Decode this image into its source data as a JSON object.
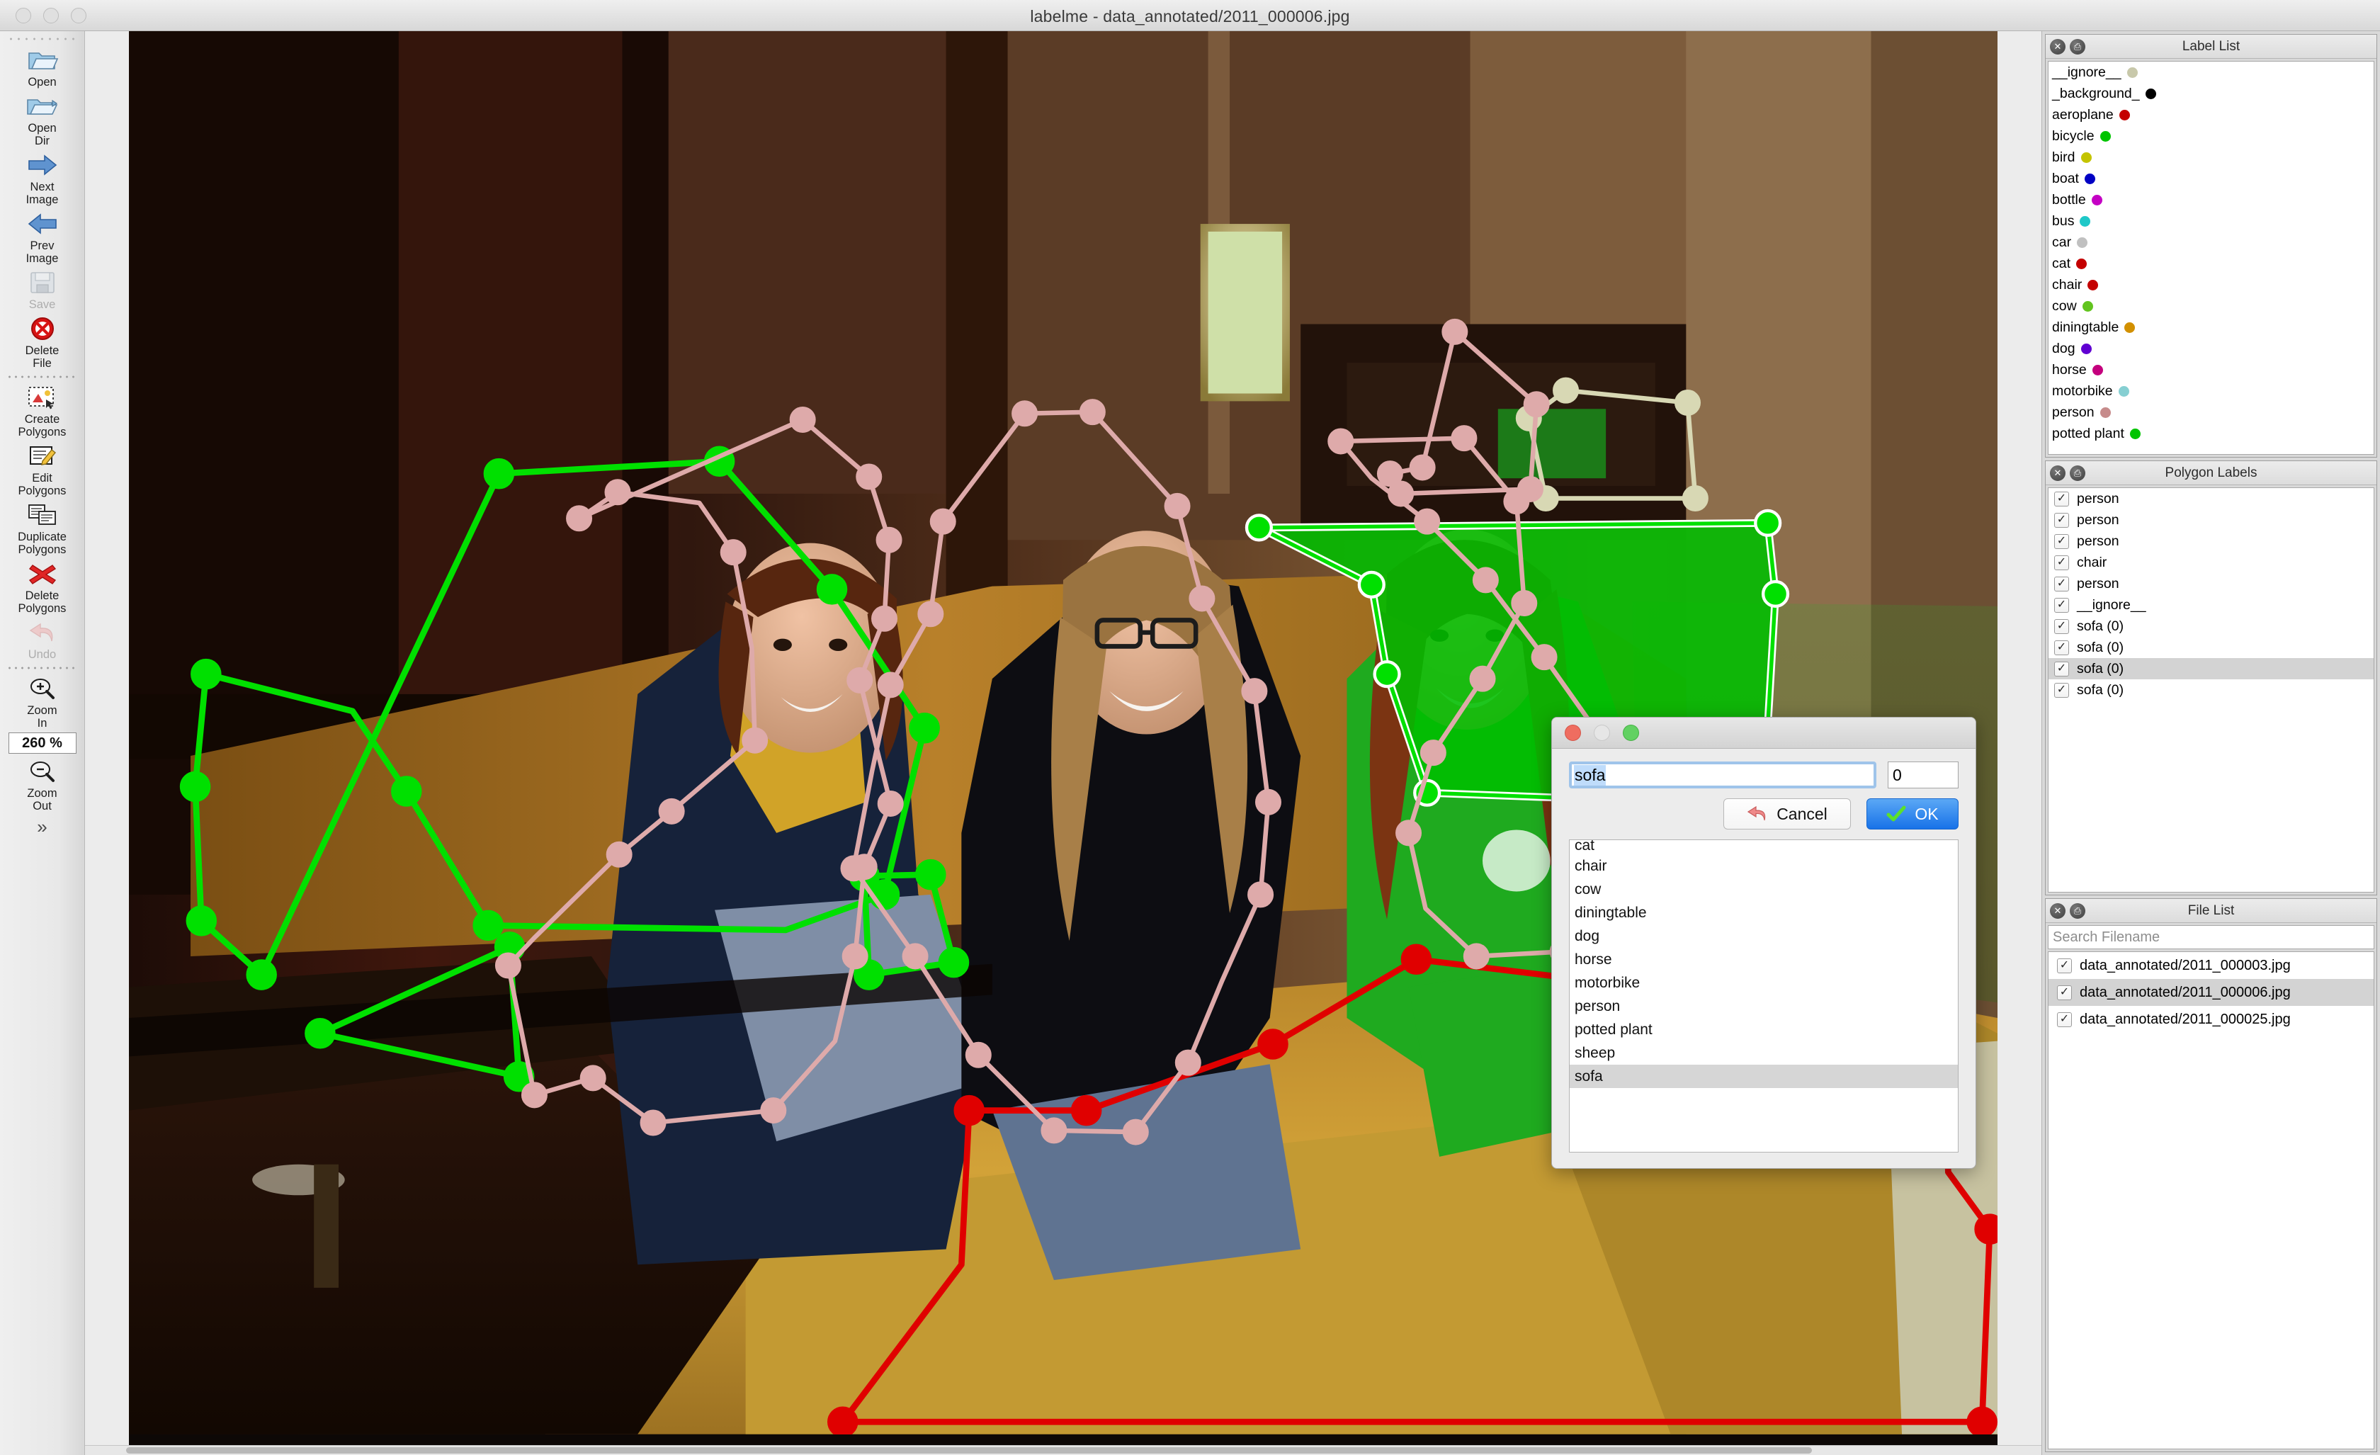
{
  "window": {
    "title": "labelme - data_annotated/2011_000006.jpg",
    "traffic": [
      "close",
      "minimize",
      "zoom"
    ]
  },
  "toolbar": {
    "items": [
      {
        "name": "open",
        "label": "Open",
        "icon": "open-folder-icon",
        "disabled": false
      },
      {
        "name": "open-dir",
        "label": "Open\nDir",
        "icon": "open-dir-icon",
        "disabled": false
      },
      {
        "name": "next-image",
        "label": "Next\nImage",
        "icon": "arrow-right-icon",
        "disabled": false
      },
      {
        "name": "prev-image",
        "label": "Prev\nImage",
        "icon": "arrow-left-icon",
        "disabled": false
      },
      {
        "name": "save",
        "label": "Save",
        "icon": "floppy-disk-icon",
        "disabled": true
      },
      {
        "name": "delete-file",
        "label": "Delete\nFile",
        "icon": "delete-circle-icon",
        "disabled": false
      },
      {
        "name": "create-polygons",
        "label": "Create\nPolygons",
        "icon": "create-polygon-icon",
        "disabled": false
      },
      {
        "name": "edit-polygons",
        "label": "Edit\nPolygons",
        "icon": "edit-pencil-icon",
        "disabled": false
      },
      {
        "name": "duplicate-polygons",
        "label": "Duplicate\nPolygons",
        "icon": "duplicate-icon",
        "disabled": false
      },
      {
        "name": "delete-polygons",
        "label": "Delete\nPolygons",
        "icon": "red-x-icon",
        "disabled": false
      },
      {
        "name": "undo",
        "label": "Undo",
        "icon": "undo-arrow-icon",
        "disabled": true
      },
      {
        "name": "zoom-in",
        "label": "Zoom\nIn",
        "icon": "magnifier-plus-icon",
        "disabled": false
      },
      {
        "name": "zoom-out",
        "label": "Zoom\nOut",
        "icon": "magnifier-minus-icon",
        "disabled": false
      }
    ],
    "zoom_value": "260 %",
    "overflow_icon": "chevron-double-down-icon"
  },
  "label_list": {
    "title": "Label List",
    "close_icon": "close-icon",
    "float_icon": "undock-icon",
    "items": [
      {
        "label": "__ignore__",
        "color": "#c8c8aa"
      },
      {
        "label": "_background_",
        "color": "#000000"
      },
      {
        "label": "aeroplane",
        "color": "#c40000"
      },
      {
        "label": "bicycle",
        "color": "#00c400"
      },
      {
        "label": "bird",
        "color": "#c4c400"
      },
      {
        "label": "boat",
        "color": "#0000c4"
      },
      {
        "label": "bottle",
        "color": "#c400c4"
      },
      {
        "label": "bus",
        "color": "#1fc8c8"
      },
      {
        "label": "car",
        "color": "#c0c0c0"
      },
      {
        "label": "cat",
        "color": "#c40000"
      },
      {
        "label": "chair",
        "color": "#c40000"
      },
      {
        "label": "cow",
        "color": "#62c41f"
      },
      {
        "label": "diningtable",
        "color": "#d29000"
      },
      {
        "label": "dog",
        "color": "#6000d2"
      },
      {
        "label": "horse",
        "color": "#c4007d"
      },
      {
        "label": "motorbike",
        "color": "#86cfd2"
      },
      {
        "label": "person",
        "color": "#c68b8b"
      },
      {
        "label": "potted plant",
        "color": "#00c400"
      }
    ]
  },
  "polygon_labels": {
    "title": "Polygon Labels",
    "close_icon": "close-icon",
    "float_icon": "undock-icon",
    "items": [
      {
        "label": "person",
        "color": "#c68b8b",
        "checked": true,
        "selected": false
      },
      {
        "label": "person",
        "color": "#c68b8b",
        "checked": true,
        "selected": false
      },
      {
        "label": "person",
        "color": "#c68b8b",
        "checked": true,
        "selected": false
      },
      {
        "label": "chair",
        "color": "#c40000",
        "checked": true,
        "selected": false
      },
      {
        "label": "person",
        "color": "#c68b8b",
        "checked": true,
        "selected": false
      },
      {
        "label": "__ignore__",
        "color": "#c8c8aa",
        "checked": true,
        "selected": false
      },
      {
        "label": "sofa (0)",
        "color": "#00c400",
        "checked": true,
        "selected": false
      },
      {
        "label": "sofa (0)",
        "color": "#00c400",
        "checked": true,
        "selected": false
      },
      {
        "label": "sofa (0)",
        "color": "#00c400",
        "checked": true,
        "selected": true
      },
      {
        "label": "sofa (0)",
        "color": "#00c400",
        "checked": true,
        "selected": false
      }
    ]
  },
  "file_list": {
    "title": "File List",
    "close_icon": "close-icon",
    "float_icon": "undock-icon",
    "search_placeholder": "Search Filename",
    "search_value": "",
    "items": [
      {
        "name": "data_annotated/2011_000003.jpg",
        "checked": true,
        "selected": false
      },
      {
        "name": "data_annotated/2011_000006.jpg",
        "checked": true,
        "selected": true
      },
      {
        "name": "data_annotated/2011_000025.jpg",
        "checked": true,
        "selected": false
      }
    ]
  },
  "dialog": {
    "traffic": [
      "close",
      "minimize",
      "zoom"
    ],
    "label_value": "sofa",
    "group_id_value": "0",
    "cancel_label": "Cancel",
    "cancel_icon": "undo-arrow-icon",
    "ok_label": "OK",
    "ok_icon": "green-check-icon",
    "list_items": [
      {
        "label": "cat",
        "selected": false,
        "clipped": true
      },
      {
        "label": "chair",
        "selected": false
      },
      {
        "label": "cow",
        "selected": false
      },
      {
        "label": "diningtable",
        "selected": false
      },
      {
        "label": "dog",
        "selected": false
      },
      {
        "label": "horse",
        "selected": false
      },
      {
        "label": "motorbike",
        "selected": false
      },
      {
        "label": "person",
        "selected": false
      },
      {
        "label": "potted plant",
        "selected": false
      },
      {
        "label": "sheep",
        "selected": false
      },
      {
        "label": "sofa",
        "selected": true
      }
    ]
  },
  "canvas": {
    "image_description": "Three smiling young women seated on a gold/mustard velvet sofa in a dim wood-panelled room",
    "colors": {
      "person": "#deaaaa",
      "chair": "#e00000",
      "sofa_selected_stroke": "#00e000",
      "sofa_selected_fill": "rgba(0,200,0,0.85)",
      "ignore": "#d8d8b4"
    }
  }
}
